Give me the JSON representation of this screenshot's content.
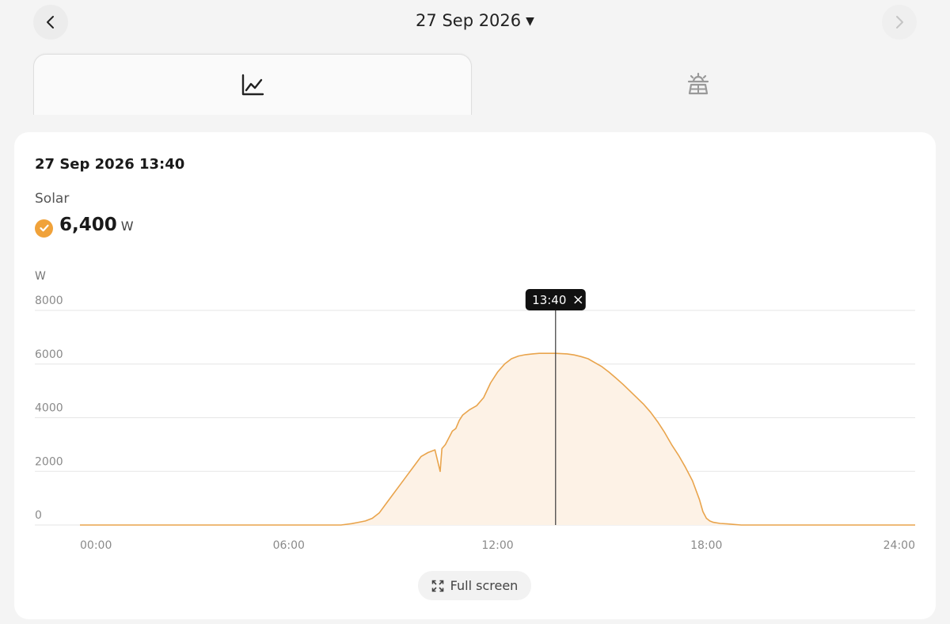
{
  "header": {
    "date": "27 Sep 2026",
    "prev_icon": "chevron-left-icon",
    "next_icon": "chevron-right-icon",
    "caret_icon": "caret-down-icon"
  },
  "tabs": [
    {
      "name": "chart",
      "icon": "line-chart-icon",
      "active": true
    },
    {
      "name": "solar-panel",
      "icon": "solar-panel-icon",
      "active": false
    }
  ],
  "card": {
    "timestamp": "27 Sep 2026 13:40",
    "series_label": "Solar",
    "value": "6,400",
    "unit": "W",
    "axis_unit": "W",
    "fullscreen_label": "Full screen"
  },
  "colors": {
    "accent": "#f0a23a",
    "line": "#e9a44c",
    "area": "#fdf2e6",
    "cursor": "#3a3a3a"
  },
  "chart_data": {
    "type": "area",
    "ylabel": "W",
    "ylim": [
      0,
      8000
    ],
    "yticks": [
      "8000",
      "6000",
      "4000",
      "2000",
      "0"
    ],
    "yticks_values": [
      8000,
      6000,
      4000,
      2000,
      0
    ],
    "xticks": [
      "00:00",
      "06:00",
      "12:00",
      "18:00",
      "24:00"
    ],
    "xticks_values": [
      0,
      6,
      12,
      18,
      24
    ],
    "xlim": [
      0,
      24
    ],
    "grid": true,
    "cursor": {
      "x": 13.667,
      "label": "13:40"
    },
    "series": [
      {
        "name": "Solar",
        "x": [
          0,
          7.5,
          7.8,
          8.0,
          8.2,
          8.4,
          8.6,
          8.8,
          9.0,
          9.2,
          9.4,
          9.6,
          9.8,
          10.0,
          10.2,
          10.35,
          10.4,
          10.5,
          10.7,
          10.8,
          10.9,
          11.0,
          11.2,
          11.4,
          11.6,
          11.8,
          12.0,
          12.2,
          12.4,
          12.6,
          12.8,
          13.0,
          13.2,
          13.4,
          13.667,
          14.0,
          14.2,
          14.4,
          14.6,
          14.8,
          15.0,
          15.2,
          15.4,
          15.6,
          15.8,
          16.0,
          16.2,
          16.4,
          16.6,
          16.8,
          17.0,
          17.2,
          17.4,
          17.6,
          17.8,
          17.9,
          18.0,
          18.1,
          18.2,
          18.4,
          18.6,
          18.8,
          19.0,
          19.4,
          24
        ],
        "y": [
          0,
          0,
          50,
          100,
          150,
          250,
          450,
          800,
          1150,
          1500,
          1850,
          2200,
          2550,
          2700,
          2800,
          2000,
          2850,
          3000,
          3500,
          3600,
          3900,
          4100,
          4300,
          4450,
          4750,
          5300,
          5700,
          6000,
          6200,
          6300,
          6350,
          6380,
          6400,
          6400,
          6400,
          6380,
          6340,
          6280,
          6200,
          6050,
          5900,
          5700,
          5480,
          5250,
          5000,
          4750,
          4500,
          4200,
          3850,
          3450,
          3000,
          2600,
          2150,
          1650,
          950,
          500,
          250,
          150,
          100,
          60,
          40,
          20,
          0,
          0,
          0
        ]
      }
    ]
  }
}
